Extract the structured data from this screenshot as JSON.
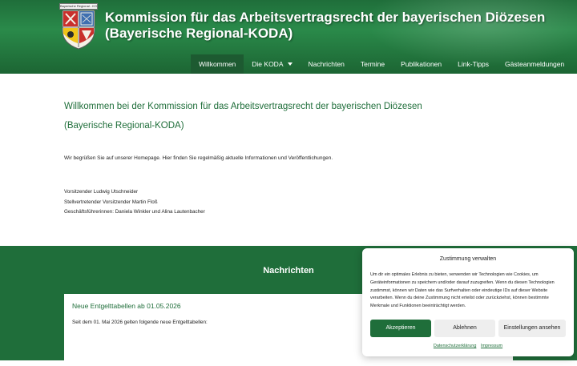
{
  "header": {
    "logo_caption": "Bayerische Regional - KODA",
    "title_line1": "Kommission für das Arbeitsvertragsrecht der bayerischen Diözesen",
    "title_line2": "(Bayerische Regional-KODA)",
    "brand_color": "#1f6e3a"
  },
  "nav": {
    "items": [
      {
        "label": "Willkommen",
        "active": true
      },
      {
        "label": "Die KODA",
        "has_dropdown": true
      },
      {
        "label": "Nachrichten"
      },
      {
        "label": "Termine"
      },
      {
        "label": "Publikationen"
      },
      {
        "label": "Link-Tipps"
      },
      {
        "label": "Gästeanmeldungen"
      }
    ]
  },
  "main": {
    "welcome_title": "Willkommen bei der Kommission für das Arbeitsvertragsrecht der bayerischen Diözesen",
    "welcome_subtitle": "(Bayerische Regional-KODA)",
    "intro": "Wir begrüßen Sie auf unserer Homepage. Hier finden Sie regelmäßig aktuelle Informationen und Veröffentlichungen.",
    "people": [
      "Vorsitzender Ludwig Utschneider",
      "Stellvertretender Vorsitzender Martin Floß",
      "Geschäftsführerinnen: Daniela Winkler und Alina Lautenbacher"
    ]
  },
  "news": {
    "heading": "Nachrichten",
    "card_title": "Neue Entgelttabellen ab 01.05.2026",
    "card_text": "Seit dem 01. Mai 2026 gelten folgende neue Entgelttabellen:"
  },
  "consent": {
    "title": "Zustimmung verwalten",
    "body": "Um dir ein optimales Erlebnis zu bieten, verwenden wir Technologien wie Cookies, um Geräteinformationen zu speichern und/oder darauf zuzugreifen. Wenn du diesen Technologien zustimmst, können wir Daten wie das Surfverhalten oder eindeutige IDs auf dieser Website verarbeiten. Wenn du deine Zustimmung nicht erteilst oder zurückziehst, können bestimmte Merkmale und Funktionen beeinträchtigt werden.",
    "accept_label": "Akzeptieren",
    "deny_label": "Ablehnen",
    "settings_label": "Einstellungen ansehen",
    "link_privacy": "Datenschutzerklärung",
    "link_imprint": "Impressum"
  }
}
